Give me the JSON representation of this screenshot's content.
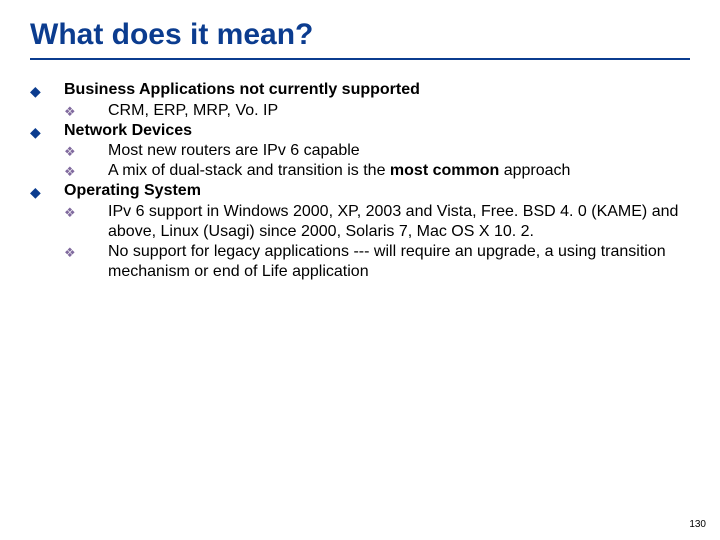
{
  "title": "What does it mean?",
  "sections": [
    {
      "heading": "Business Applications not currently supported",
      "items": [
        {
          "text": "CRM, ERP, MRP, Vo. IP"
        }
      ]
    },
    {
      "heading": "Network Devices",
      "items": [
        {
          "text": "Most new routers are IPv 6 capable"
        },
        {
          "pre": "A mix of dual-stack and transition is the ",
          "bold": "most common",
          "post": " approach"
        }
      ]
    },
    {
      "heading": "Operating System",
      "items": [
        {
          "text": "IPv 6 support in Windows 2000, XP, 2003 and Vista, Free. BSD 4. 0 (KAME) and above, Linux (Usagi) since 2000, Solaris 7, Mac OS X 10. 2."
        },
        {
          "text": "No support for legacy applications --- will require an upgrade, a using transition mechanism or end of Life application"
        }
      ]
    }
  ],
  "page_number": "130"
}
